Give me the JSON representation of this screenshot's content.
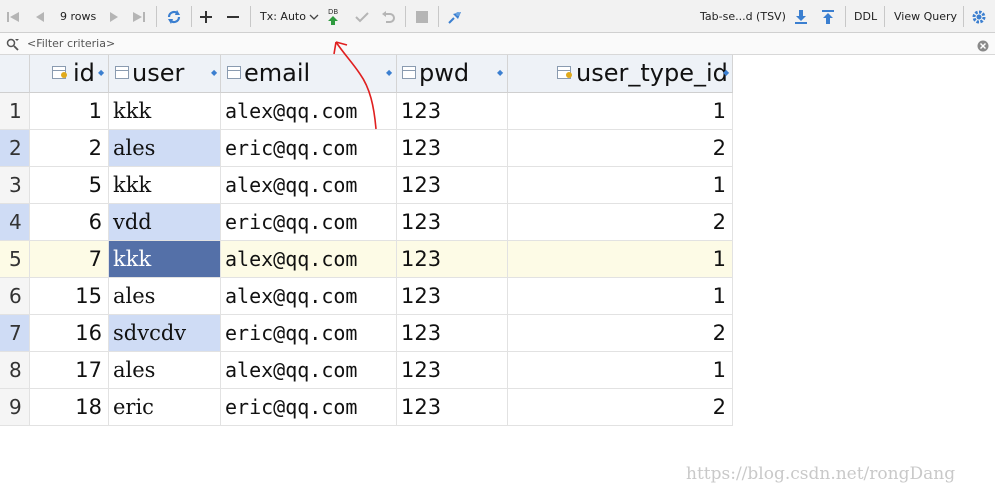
{
  "toolbar": {
    "row_count": "9 rows",
    "tx_mode": "Tx: Auto",
    "db_badge": "DB",
    "export_format": "Tab-se...d (TSV)",
    "ddl_label": "DDL",
    "view_query_label": "View Query"
  },
  "filter": {
    "placeholder": "<Filter criteria>"
  },
  "table": {
    "columns": [
      "id",
      "user",
      "email",
      "pwd",
      "user_type_id"
    ],
    "rows": [
      {
        "rownum": "1",
        "id": "1",
        "user": "kkk",
        "email": "alex@qq.com",
        "pwd": "123",
        "user_type_id": "1"
      },
      {
        "rownum": "2",
        "id": "2",
        "user": "ales",
        "email": "eric@qq.com",
        "pwd": "123",
        "user_type_id": "2"
      },
      {
        "rownum": "3",
        "id": "5",
        "user": "kkk",
        "email": "alex@qq.com",
        "pwd": "123",
        "user_type_id": "1"
      },
      {
        "rownum": "4",
        "id": "6",
        "user": "vdd",
        "email": "eric@qq.com",
        "pwd": "123",
        "user_type_id": "2"
      },
      {
        "rownum": "5",
        "id": "7",
        "user": "kkk",
        "email": "alex@qq.com",
        "pwd": "123",
        "user_type_id": "1"
      },
      {
        "rownum": "6",
        "id": "15",
        "user": "ales",
        "email": "alex@qq.com",
        "pwd": "123",
        "user_type_id": "1"
      },
      {
        "rownum": "7",
        "id": "16",
        "user": "sdvcdv",
        "email": "eric@qq.com",
        "pwd": "123",
        "user_type_id": "2"
      },
      {
        "rownum": "8",
        "id": "17",
        "user": "ales",
        "email": "alex@qq.com",
        "pwd": "123",
        "user_type_id": "1"
      },
      {
        "rownum": "9",
        "id": "18",
        "user": "eric",
        "email": "eric@qq.com",
        "pwd": "123",
        "user_type_id": "2"
      }
    ],
    "highlighted_user_rows": [
      1,
      3,
      6
    ],
    "current_row": 4,
    "selected_cell_color": "#5470a8",
    "highlight_color": "#cfdcf5",
    "current_row_color": "#fdfbe6"
  },
  "watermark": "https://blog.csdn.net/rongDang",
  "colors": {
    "accent_blue": "#3b7fd0",
    "annotation_red": "#e02020",
    "db_icon_green": "#2e9a3e"
  }
}
